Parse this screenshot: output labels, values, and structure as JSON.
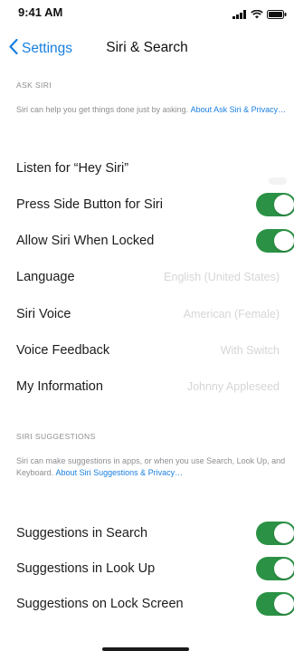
{
  "status": {
    "time": "9:41 AM"
  },
  "nav": {
    "back_label": "Settings",
    "title": "Siri & Search"
  },
  "ask_siri": {
    "header": "ASK SIRI",
    "footer_text": "Siri can help you get things done just by asking.",
    "footer_link": "About Ask Siri & Privacy…"
  },
  "rows_ask": [
    {
      "label": "Listen for “Hey Siri”",
      "toggle": false
    },
    {
      "label": "Press Side Button for Siri",
      "toggle": true
    },
    {
      "label": "Allow Siri When Locked",
      "toggle": true
    },
    {
      "label": "Language",
      "value": "English (United States)"
    },
    {
      "label": "Siri Voice",
      "value": "American (Female)"
    },
    {
      "label": "Voice Feedback",
      "value": "With Switch"
    },
    {
      "label": "My Information",
      "value": "Johnny Appleseed"
    }
  ],
  "suggestions": {
    "header": "SIRI SUGGESTIONS",
    "footer_text": "Siri can make suggestions in apps, or when you use Search, Look Up, and Keyboard.",
    "footer_link": "About Siri Suggestions & Privacy…"
  },
  "rows_suggest": [
    {
      "label": "Suggestions in Search",
      "toggle": true
    },
    {
      "label": "Suggestions in Look Up",
      "toggle": true
    },
    {
      "label": "Suggestions on Lock Screen",
      "toggle": true
    }
  ],
  "colors": {
    "accent": "#1a7fe0",
    "toggle_on": "#2b9245",
    "secondary": "#8e8e93"
  },
  "icons": {
    "back": "chevron-left-icon",
    "signal": "signal-icon",
    "wifi": "wifi-icon",
    "battery": "battery-icon"
  }
}
